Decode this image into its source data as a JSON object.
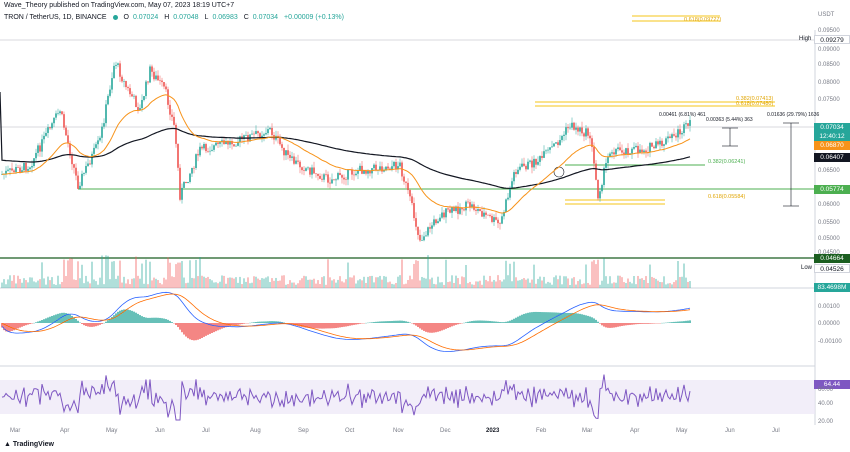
{
  "author_line": "Wave_Theory published on TradingView.com, May 07, 2023 18:19 UTC+7",
  "symbol": "TRON / TetherUS, 1D, BINANCE",
  "ohlc": {
    "o_label": "O",
    "o": "0.07024",
    "h_label": "H",
    "h": "0.07048",
    "l_label": "L",
    "l": "0.06983",
    "c_label": "C",
    "c": "0.07034",
    "chg": "+0.00009 (+0.13%)"
  },
  "currency": "USDT",
  "price_ticks": [
    "0.09500",
    "0.09000",
    "0.08500",
    "0.08000",
    "0.07500",
    "0.06500",
    "0.06000",
    "0.05500",
    "0.05000",
    "0.04500"
  ],
  "labels": {
    "high_label": "High",
    "high_value": "0.09279",
    "low_label": "Low",
    "low_value": "0.04526",
    "last_price": "0.07034",
    "countdown": "12:40:12",
    "ema50": "0.06870",
    "ema200": "0.06407",
    "support1": "0.05774",
    "support2": "0.04664",
    "volume": "83.4698M",
    "macd_ticks": [
      "0.00100",
      "0.00000",
      "-0.00100"
    ],
    "rsi_value": "64.44",
    "rsi_ticks": [
      "60.00",
      "40.00",
      "20.00"
    ]
  },
  "fib_labels": {
    "top": "0.618(0.09727)",
    "mid_a": "0.382(0.07413)",
    "mid_b": "0.618(0.07480)",
    "green": "0.382(0.06241)",
    "low": "0.618(0.05584)"
  },
  "measures": {
    "m1": "0.00461 (6.81%) 461",
    "m2": "0.00363 (5.44%) 363",
    "m3": "0.01636 (29.79%) 1636"
  },
  "months": [
    "Mar",
    "Apr",
    "May",
    "Jun",
    "Jul",
    "Aug",
    "Sep",
    "Oct",
    "Nov",
    "Dec",
    "2023",
    "Feb",
    "Mar",
    "Apr",
    "May",
    "Jun",
    "Jul"
  ],
  "footer_logo": "TradingView",
  "colors": {
    "up": "#26a69a",
    "down": "#ef5350",
    "ema50": "#f7931a",
    "ema200": "#131722",
    "support": "#4caf50",
    "fib": "#f5c518",
    "macd": "#2962ff",
    "signal": "#ff6d00",
    "rsi": "#7e57c2"
  }
}
